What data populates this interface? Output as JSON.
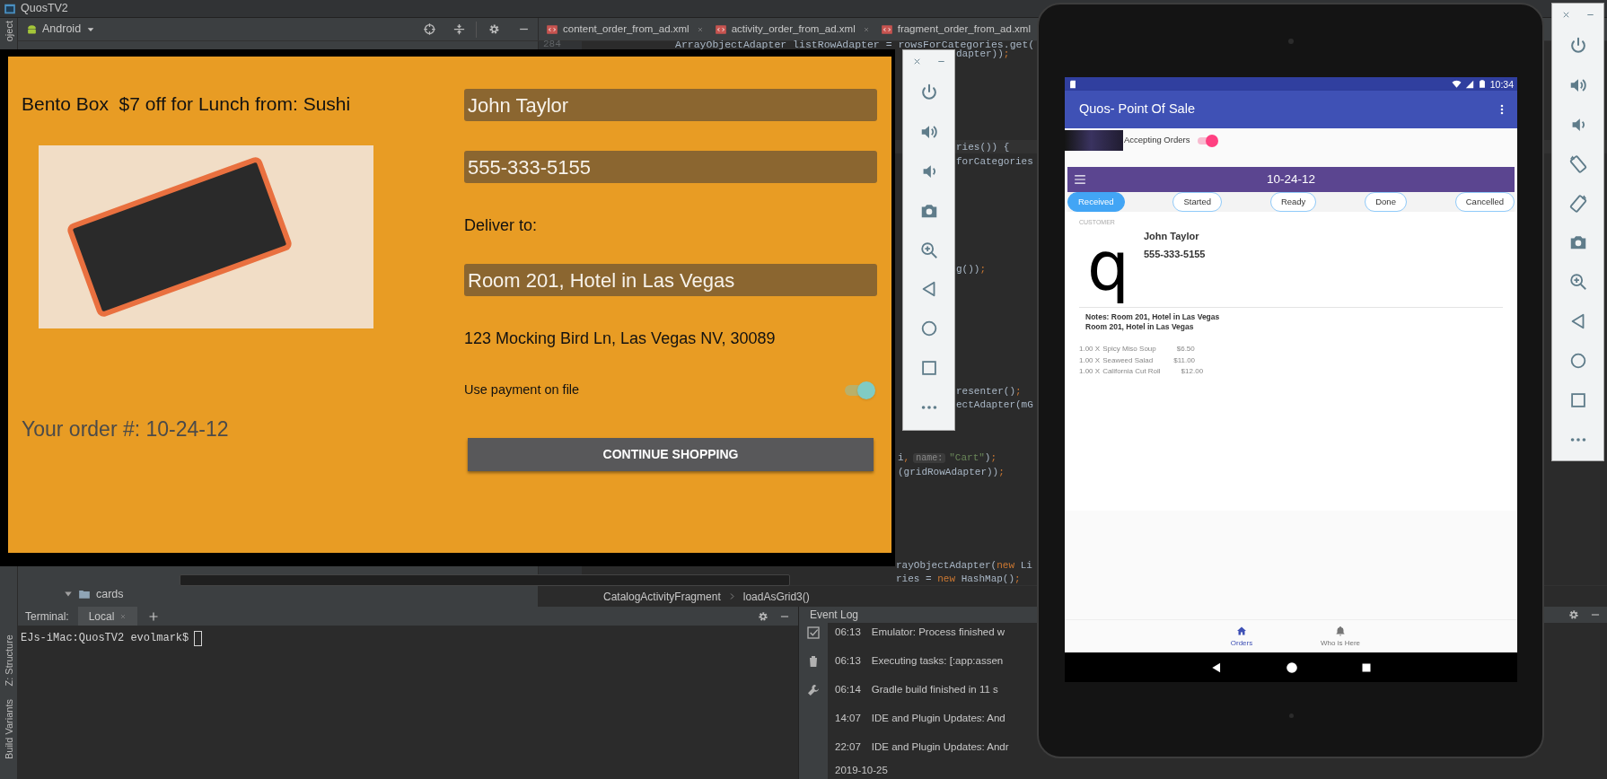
{
  "ide": {
    "title": "QuosTV2",
    "side_tabs": [
      "oject",
      "Z: Structure",
      "Build Variants"
    ],
    "project_view": "Android",
    "editor_tabs": [
      {
        "label": "content_order_from_ad.xml",
        "selected": false
      },
      {
        "label": "activity_order_from_ad.xml",
        "selected": false
      },
      {
        "label": "fragment_order_from_ad.xml",
        "selected": false
      }
    ],
    "line_number": "284",
    "code_lines": [
      {
        "parts": [
          {
            "kind": "plain",
            "text": "ArrayObjectAdapter listRowAdapter = rowsForCategories.get("
          }
        ]
      },
      {
        "parts": [
          {
            "kind": "plain",
            "text": "dapter))"
          },
          {
            "kind": "punct",
            "text": ";"
          }
        ]
      },
      {
        "parts": [
          {
            "kind": "plain",
            "text": "ries()) {"
          }
        ]
      },
      {
        "parts": [
          {
            "kind": "plain",
            "text": "forCategories"
          }
        ]
      },
      {
        "parts": [
          {
            "kind": "plain",
            "text": "g())"
          },
          {
            "kind": "punct",
            "text": ";"
          }
        ]
      },
      {
        "parts": [
          {
            "kind": "plain",
            "text": "resenter()"
          },
          {
            "kind": "punct",
            "text": ";"
          }
        ]
      },
      {
        "parts": [
          {
            "kind": "plain",
            "text": "ectAdapter(mG"
          }
        ]
      },
      {
        "parts": [
          {
            "kind": "plain",
            "text": "i"
          },
          {
            "kind": "punct",
            "text": ","
          },
          {
            "kind": "hint",
            "text": "name:"
          },
          {
            "kind": "string",
            "text": "\"Cart\""
          },
          {
            "kind": "plain",
            "text": ")"
          },
          {
            "kind": "punct",
            "text": ";"
          }
        ]
      },
      {
        "parts": [
          {
            "kind": "plain",
            "text": "(gridRowAdapter))"
          },
          {
            "kind": "punct",
            "text": ";"
          }
        ]
      },
      {
        "parts": [
          {
            "kind": "plain",
            "text": "rayObjectAdapter("
          },
          {
            "kind": "keyword",
            "text": "new"
          },
          {
            "kind": "plain",
            "text": " Li"
          }
        ]
      },
      {
        "parts": [
          {
            "kind": "plain",
            "text": "ries = "
          },
          {
            "kind": "keyword",
            "text": "new"
          },
          {
            "kind": "plain",
            "text": " HashMap()"
          },
          {
            "kind": "punct",
            "text": ";"
          }
        ]
      }
    ],
    "breadcrumb": [
      "CatalogActivityFragment",
      "loadAsGrid3()"
    ],
    "project_tree": [
      {
        "label": "cards",
        "expanded": true
      }
    ],
    "terminal": {
      "title": "Terminal:",
      "tabs": [
        {
          "label": "Local",
          "selected": true
        }
      ],
      "prompt": "EJs-iMac:QuosTV2 evolmark$"
    },
    "event_log": {
      "title": "Event Log",
      "entries": [
        {
          "time": "06:13",
          "message": "Emulator: Process finished w"
        },
        {
          "time": "06:13",
          "message": "Executing tasks: [:app:assen"
        },
        {
          "time": "06:14",
          "message": "Gradle build finished in 11 s"
        },
        {
          "time": "14:07",
          "message": "IDE and Plugin Updates: And"
        },
        {
          "time": "22:07",
          "message": "IDE and Plugin Updates: Andr"
        }
      ],
      "date": "2019-10-25"
    }
  },
  "tv_app": {
    "offer": "Bento Box  $7 off for Lunch from: Sushi",
    "order_number": "Your order #: 10-24-12",
    "form": [
      {
        "kind": "input",
        "value": "John Taylor"
      },
      {
        "kind": "input",
        "value": "555-333-5155"
      },
      {
        "kind": "label",
        "text": "Deliver to:"
      },
      {
        "kind": "input",
        "value": "Room 201, Hotel in Las Vegas"
      },
      {
        "kind": "label",
        "text": "123 Mocking Bird Ln, Las Vegas NV, 30089"
      },
      {
        "kind": "switch",
        "text": "Use payment on file",
        "on": true
      },
      {
        "kind": "button",
        "text": "CONTINUE SHOPPING"
      }
    ]
  },
  "tablet_app": {
    "time": "10:34",
    "title": "Quos- Point Of Sale",
    "accepting": {
      "label": "Accepting Orders",
      "on": true
    },
    "order_title": "10-24-12",
    "status_tabs": [
      {
        "label": "Received",
        "selected": true
      },
      {
        "label": "Started",
        "selected": false
      },
      {
        "label": "Ready",
        "selected": false
      },
      {
        "label": "Done",
        "selected": false
      },
      {
        "label": "Cancelled",
        "selected": false
      }
    ],
    "customer_label": "CUSTOMER",
    "logo_letter": "q",
    "customer_name": "John Taylor",
    "customer_phone": "555-333-5155",
    "notes": [
      "Notes: Room 201, Hotel in Las Vegas",
      "Room 201, Hotel in Las Vegas"
    ],
    "items": [
      {
        "qty": "1.00 X",
        "name": "Spicy Miso Soup",
        "price": "$6.50"
      },
      {
        "qty": "1.00 X",
        "name": "Seaweed Salad",
        "price": "$11.00"
      },
      {
        "qty": "1.00 X",
        "name": "California Cut Roll",
        "price": "$12.00"
      }
    ],
    "bottom_nav": [
      {
        "label": "Orders",
        "kind": "home",
        "selected": true
      },
      {
        "label": "Who is Here",
        "kind": "bell",
        "selected": false
      }
    ]
  }
}
